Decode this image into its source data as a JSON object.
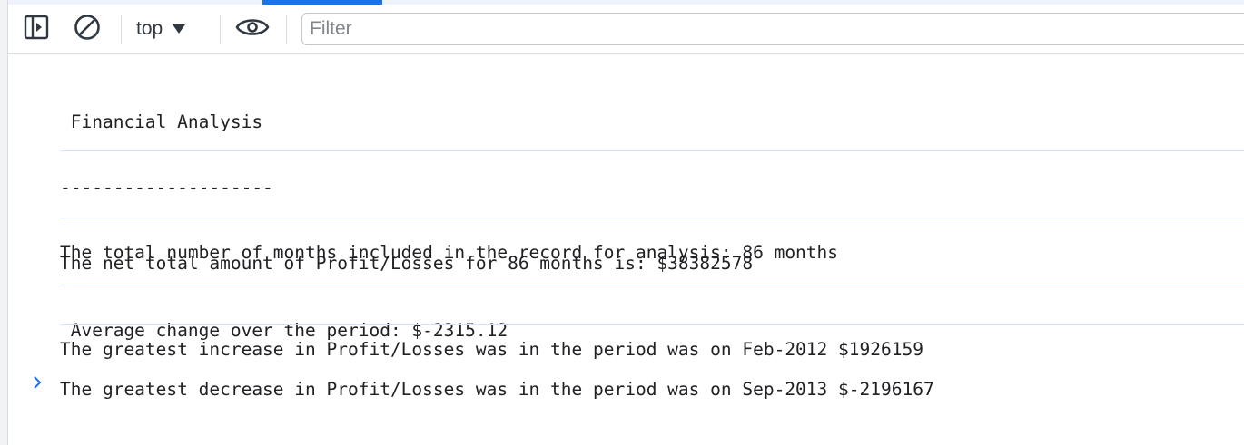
{
  "toolbar": {
    "context": "top",
    "filter_placeholder": "Filter",
    "filter_value": ""
  },
  "console": {
    "messages": [
      {
        "lines": [
          " Financial Analysis",
          "--------------------",
          "The total number of months included in the record for analysis: 86 months"
        ]
      },
      {
        "lines": [
          "",
          "The net total amount of Profit/Losses for 86 months is: $38382578"
        ]
      },
      {
        "lines": [
          "",
          " Average change over the period: $-2315.12"
        ]
      },
      {
        "lines": [
          "The greatest increase in Profit/Losses was in the period was on Feb-2012 $1926159"
        ]
      },
      {
        "lines": [
          "The greatest decrease in Profit/Losses was in the period was on Sep-2013 $-2196167"
        ]
      }
    ]
  },
  "colors": {
    "accent": "#1a73e8",
    "divider": "#d3e3fd",
    "prompt": "#1a73e8",
    "icon": "#303942"
  }
}
